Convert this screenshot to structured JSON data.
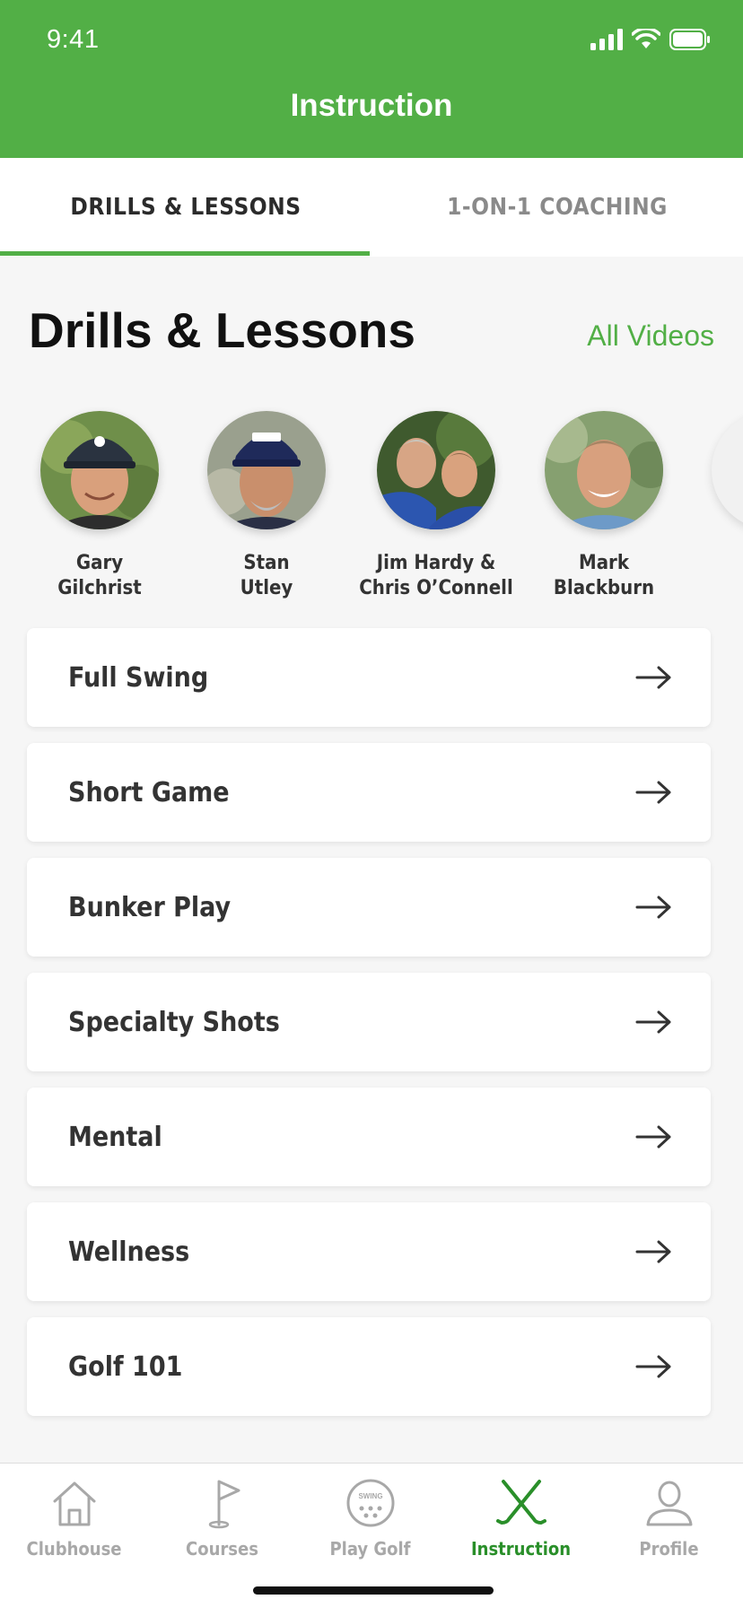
{
  "status_bar": {
    "time": "9:41"
  },
  "header": {
    "title": "Instruction"
  },
  "tabs": [
    {
      "label": "DRILLS & LESSONS",
      "active": true
    },
    {
      "label": "1-ON-1 COACHING",
      "active": false
    }
  ],
  "section": {
    "title": "Drills & Lessons",
    "link_label": "All Videos"
  },
  "instructors": [
    {
      "name_line1": "Gary",
      "name_line2": "Gilchrist"
    },
    {
      "name_line1": "Stan",
      "name_line2": "Utley"
    },
    {
      "name_line1": "Jim Hardy &",
      "name_line2": "Chris O’Connell"
    },
    {
      "name_line1": "Mark",
      "name_line2": "Blackburn"
    }
  ],
  "categories": [
    {
      "label": "Full Swing"
    },
    {
      "label": "Short Game"
    },
    {
      "label": "Bunker Play"
    },
    {
      "label": "Specialty Shots"
    },
    {
      "label": "Mental"
    },
    {
      "label": "Wellness"
    },
    {
      "label": "Golf 101"
    }
  ],
  "bottom_nav": [
    {
      "label": "Clubhouse",
      "icon": "house-icon",
      "active": false
    },
    {
      "label": "Courses",
      "icon": "flag-icon",
      "active": false
    },
    {
      "label": "Play Golf",
      "icon": "golf-ball-icon",
      "active": false,
      "icon_text": "SWING"
    },
    {
      "label": "Instruction",
      "icon": "crossed-clubs-icon",
      "active": true
    },
    {
      "label": "Profile",
      "icon": "person-icon",
      "active": false
    }
  ],
  "colors": {
    "brand_green": "#52af46",
    "active_nav_green": "#2a8f2a",
    "inactive": "#a8a8a8"
  }
}
